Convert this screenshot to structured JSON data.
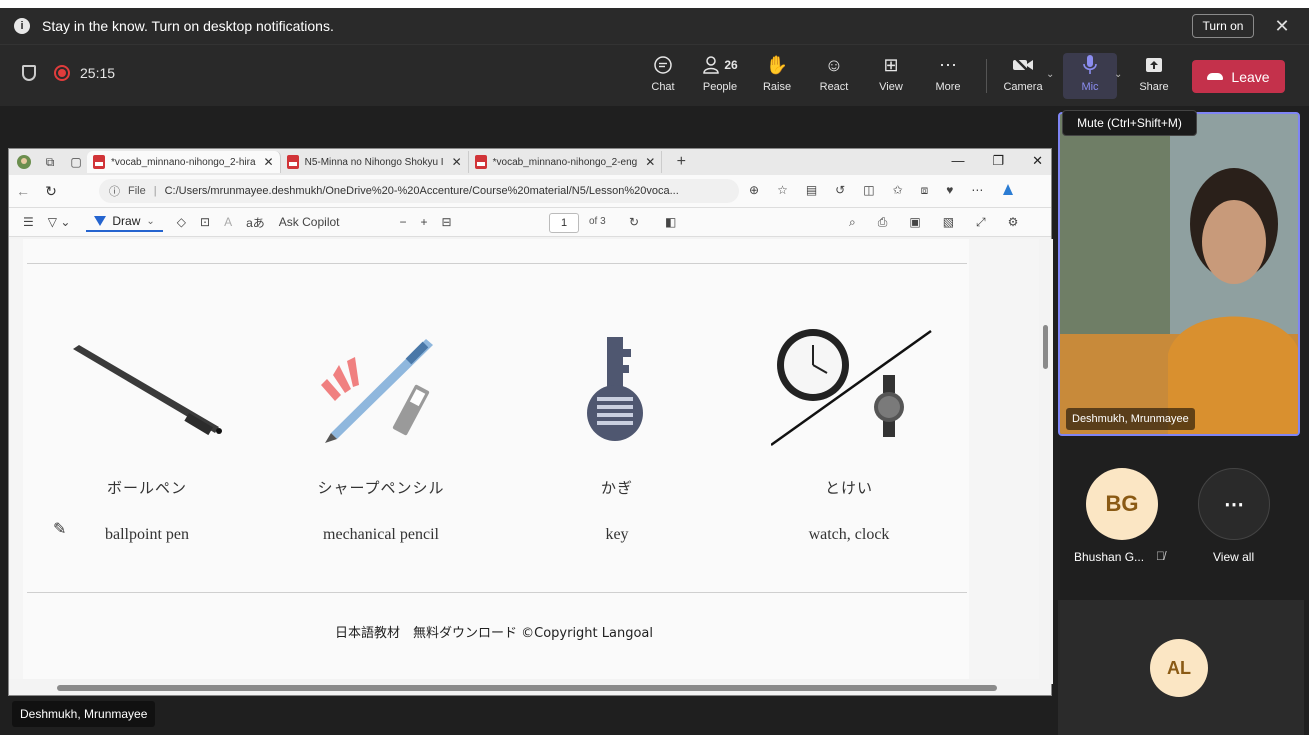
{
  "notification": {
    "text": "Stay in the know. Turn on desktop notifications.",
    "turn_on": "Turn on"
  },
  "meeting": {
    "timer": "25:15",
    "buttons": {
      "chat": "Chat",
      "people": "People",
      "people_count": "26",
      "raise": "Raise",
      "react": "React",
      "view": "View",
      "more": "More",
      "camera": "Camera",
      "mic": "Mic",
      "share": "Share",
      "leave": "Leave"
    },
    "mic_tooltip": "Mute (Ctrl+Shift+M)"
  },
  "browser": {
    "tabs": [
      {
        "label": "*vocab_minnano-nihongo_2-hira",
        "active": true
      },
      {
        "label": "N5-Minna no Nihongo Shokyu I",
        "active": false
      },
      {
        "label": "*vocab_minnano-nihongo_2-eng",
        "active": false
      }
    ],
    "address": {
      "label": "File",
      "url": "C:/Users/mrunmayee.deshmukh/OneDrive%20-%20Accenture/Course%20material/N5/Lesson%20voca..."
    },
    "pdf_toolbar": {
      "draw": "Draw",
      "ask_copilot": "Ask Copilot",
      "page": "1",
      "of": "of 3"
    }
  },
  "document": {
    "items": [
      {
        "jp": "ボールペン",
        "en": "ballpoint pen"
      },
      {
        "jp": "シャープペンシル",
        "en": "mechanical pencil"
      },
      {
        "jp": "かぎ",
        "en": "key"
      },
      {
        "jp": "とけい",
        "en": "watch, clock"
      }
    ],
    "footer": "日本語教材　無料ダウンロード ©Copyright Langoal"
  },
  "participants": {
    "presenter_tag": "Deshmukh, Mrunmayee",
    "video_name": "Deshmukh, Mrunmayee",
    "bg": {
      "initials": "BG",
      "name": "Bhushan G..."
    },
    "view_all": "View all",
    "al": {
      "initials": "AL"
    }
  },
  "colors": {
    "leave": "#c4314b",
    "mic_active": "#8b8df0",
    "accent": "#2564cf"
  }
}
